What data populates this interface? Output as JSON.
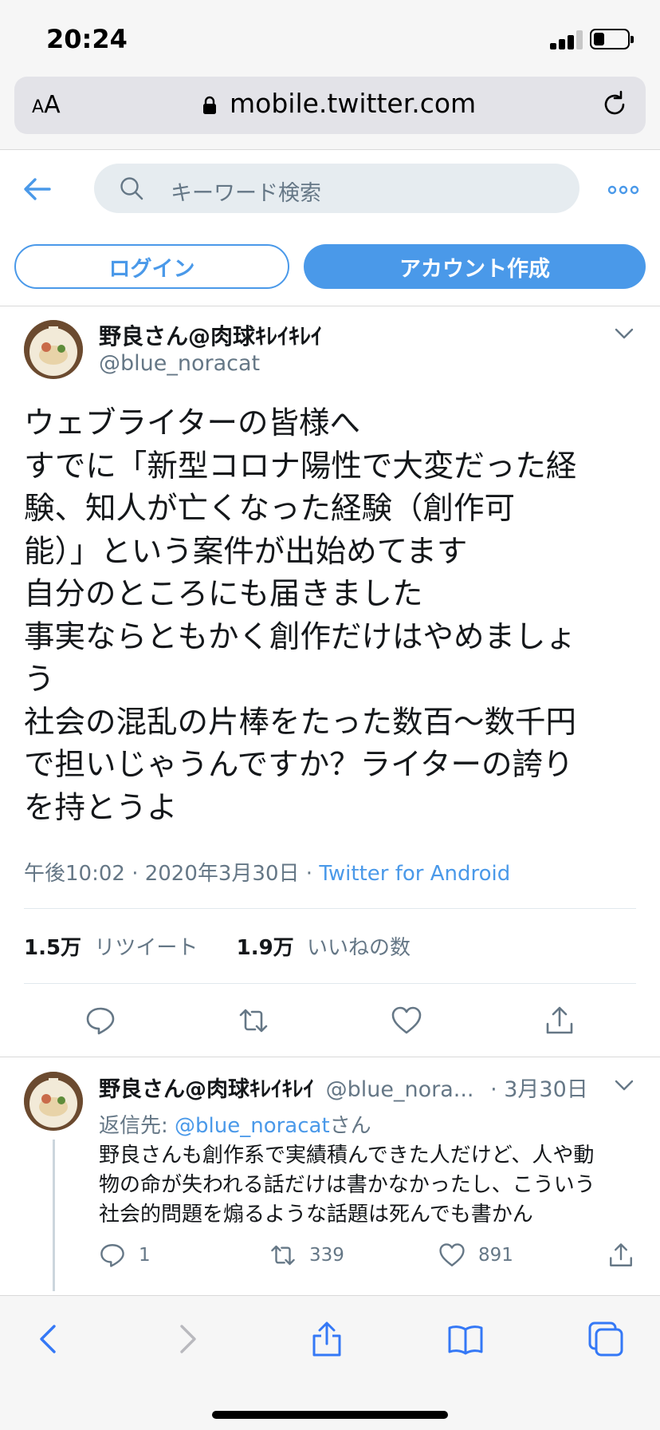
{
  "status_bar": {
    "time": "20:24"
  },
  "browser": {
    "text_size_label": "AA",
    "url": "mobile.twitter.com"
  },
  "header": {
    "search_placeholder": "キーワード検索",
    "login_label": "ログイン",
    "signup_label": "アカウント作成"
  },
  "tweet": {
    "display_name": "野良さん@肉球ｷﾚｲｷﾚｲ",
    "handle": "@blue_noracat",
    "text_lines": [
      "ウェブライターの皆様へ",
      "すでに「新型コロナ陽性で大変だった経",
      "験、知人が亡くなった経験（創作可",
      "能）」という案件が出始めてます",
      "自分のところにも届きました",
      "事実ならともかく創作だけはやめましょ",
      "う",
      "社会の混乱の片棒をたった数百〜数千円",
      "で担いじゃうんですか？ライターの誇り",
      "を持とうよ"
    ],
    "timestamp": "午後10:02 · 2020年3月30日 · ",
    "source": "Twitter for Android",
    "retweet_count": "1.5万",
    "retweet_label": "リツイート",
    "like_count": "1.9万",
    "like_label": "いいねの数"
  },
  "reply": {
    "display_name": "野良さん@肉球ｷﾚｲｷﾚｲ",
    "handle": "@blue_nora...",
    "date": "· 3月30日",
    "reply_to_prefix": "返信先: ",
    "reply_to_handle": "@blue_noracat",
    "reply_to_suffix": "さん",
    "text_lines": [
      "野良さんも創作系で実績積んできた人だけど、人や動",
      "物の命が失われる話だけは書かなかったし、こういう",
      "社会的問題を煽るような話題は死んでも書かん"
    ],
    "reply_count": "1",
    "retweet_count": "339",
    "like_count": "891"
  },
  "colors": {
    "accent": "#4a99e9",
    "muted": "#657786",
    "text": "#14171a"
  }
}
